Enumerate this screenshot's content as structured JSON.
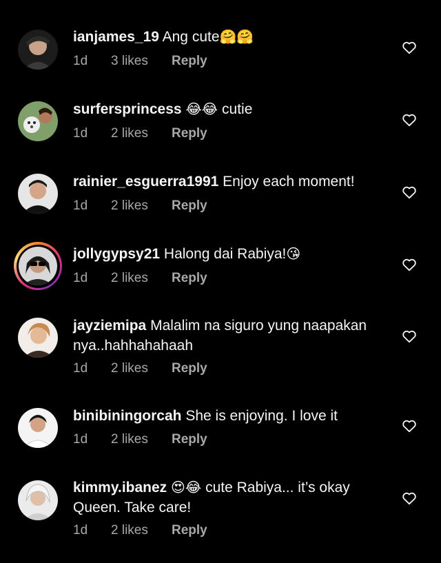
{
  "comments": [
    {
      "username": "ianjames_19",
      "text": "Ang cute",
      "emojis": "🤗🤗",
      "time": "1d",
      "likes": "3 likes",
      "reply": "Reply",
      "avatar_color": "#2a2a2a"
    },
    {
      "username": "surfersprincess",
      "emojis": "😂😂",
      "text": "cutie",
      "time": "1d",
      "likes": "2 likes",
      "reply": "Reply",
      "avatar_color": "#6b8f5a"
    },
    {
      "username": "rainier_esguerra1991",
      "text": "Enjoy each moment!",
      "time": "1d",
      "likes": "2 likes",
      "reply": "Reply",
      "avatar_color": "#e8e8e8"
    },
    {
      "username": "jollygypsy21",
      "text": "Halong dai Rabiya!",
      "emojis": "😘",
      "time": "1d",
      "likes": "2 likes",
      "reply": "Reply",
      "avatar_color": "#cfcfcf"
    },
    {
      "username": "jayziemipa",
      "text": "Malalim na siguro yung naapakan nya..hahhahahaah",
      "time": "1d",
      "likes": "2 likes",
      "reply": "Reply",
      "avatar_color": "#d9a46c"
    },
    {
      "username": "binibiningorcah",
      "text": "She is enjoying. I love it",
      "time": "1d",
      "likes": "2 likes",
      "reply": "Reply",
      "avatar_color": "#f0f0f0"
    },
    {
      "username": "kimmy.ibanez",
      "emojis": "😍😂",
      "text": "cute Rabiya... it’s okay Queen. Take care!",
      "time": "1d",
      "likes": "2 likes",
      "reply": "Reply",
      "avatar_color": "#e0e0e0"
    }
  ],
  "icons": {
    "like": "heart-outline-icon"
  },
  "colors": {
    "background": "#000000",
    "text": "#f5f5f5",
    "meta": "#a8a8a8",
    "story_ring": "#dd2a7b"
  }
}
